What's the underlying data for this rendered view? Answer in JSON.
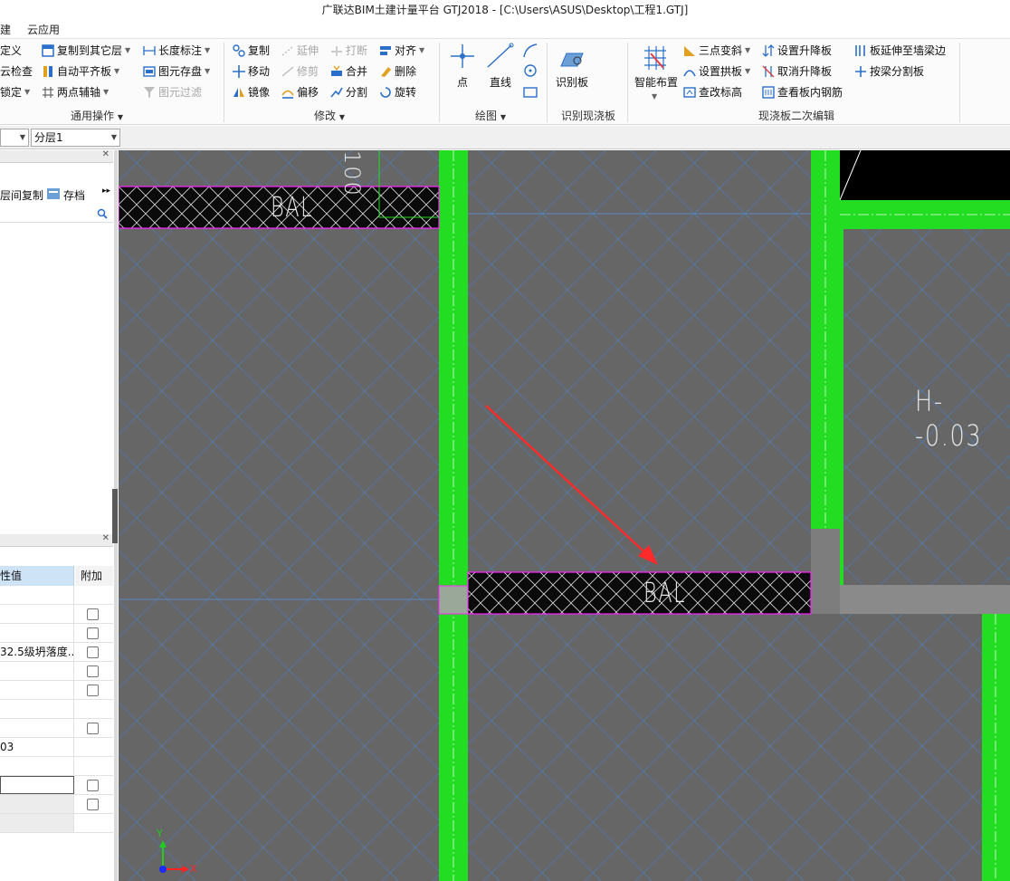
{
  "window": {
    "title": "广联达BIM土建计量平台 GTJ2018 - [C:\\Users\\ASUS\\Desktop\\工程1.GTJ]"
  },
  "menu": {
    "item_left": "建",
    "item_cloud": "云应用"
  },
  "ribbon": {
    "col1": [
      "定义",
      "云检查",
      "锁定"
    ],
    "col2": [
      "复制到其它层",
      "自动平齐板",
      "两点辅轴"
    ],
    "col3": [
      "长度标注",
      "图元存盘",
      "图元过滤"
    ],
    "group_common": "通用操作",
    "modify": [
      "复制",
      "延伸",
      "打断",
      "对齐",
      "移动",
      "修剪",
      "合并",
      "删除",
      "镜像",
      "偏移",
      "分割",
      "旋转"
    ],
    "group_modify": "修改",
    "draw": {
      "point": "点",
      "line": "直线"
    },
    "group_draw": "绘图",
    "recognize": "识别板",
    "group_recognize": "识别现浇板",
    "smart": "智能布置",
    "edit": [
      "三点变斜",
      "设置升降板",
      "板延伸至墙梁边",
      "设置拱板",
      "取消升降板",
      "按梁分割板",
      "查改标高",
      "查看板内钢筋"
    ],
    "group_edit": "现浇板二次编辑"
  },
  "layerbar": {
    "floor": "",
    "layer": "分层1"
  },
  "left_panel": {
    "tools": {
      "copy_between": "层间复制",
      "archive": "存档"
    },
    "props": {
      "header_value": "性值",
      "header_extra": "附加",
      "rows": [
        "",
        "",
        "",
        "32.5级坍落度...",
        "",
        "",
        "",
        "",
        "03",
        "",
        "",
        "",
        ""
      ],
      "checkbox_rows": [
        1,
        2,
        3,
        4,
        5,
        7,
        10,
        11
      ]
    }
  },
  "canvas": {
    "label_bal_top": "BAL",
    "label_bal_mid": "BAL",
    "label_h": "H--0.03",
    "label_dim": "100",
    "axis_x": "X",
    "axis_y": "Y"
  },
  "colors": {
    "wall_green": "#22dd22",
    "canvas_bg": "#666666",
    "grid_blue": "#4a7fb8",
    "beam_magenta": "#ff22ff",
    "arrow_red": "#ff2a2a"
  }
}
